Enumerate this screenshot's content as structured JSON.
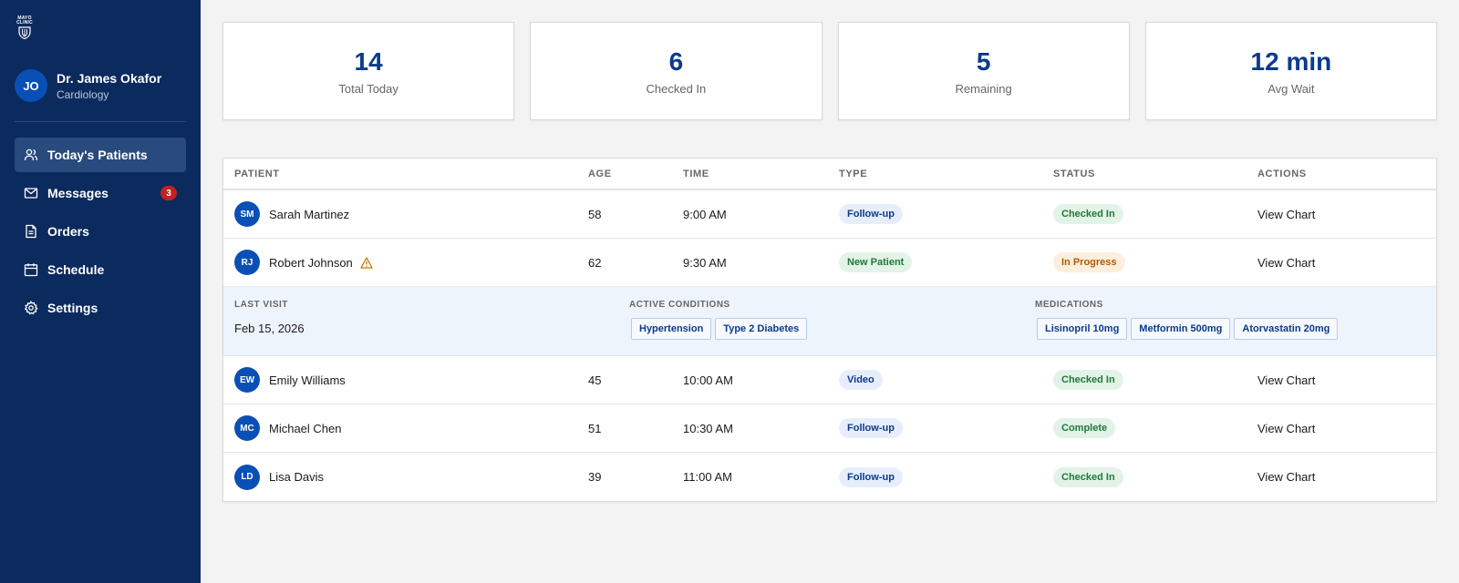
{
  "brand": {
    "logo_text": "MAYO CLINIC"
  },
  "user": {
    "initials": "JO",
    "name": "Dr. James Okafor",
    "department": "Cardiology"
  },
  "nav": {
    "items": [
      {
        "label": "Today's Patients",
        "icon": "users-icon",
        "active": true
      },
      {
        "label": "Messages",
        "icon": "mail-icon",
        "badge": "3"
      },
      {
        "label": "Orders",
        "icon": "document-icon"
      },
      {
        "label": "Schedule",
        "icon": "calendar-icon"
      },
      {
        "label": "Settings",
        "icon": "gear-icon"
      }
    ]
  },
  "stats": [
    {
      "value": "14",
      "label": "Total Today"
    },
    {
      "value": "6",
      "label": "Checked In"
    },
    {
      "value": "5",
      "label": "Remaining"
    },
    {
      "value": "12 min",
      "label": "Avg Wait"
    }
  ],
  "table": {
    "headers": {
      "patient": "PATIENT",
      "age": "AGE",
      "time": "TIME",
      "type": "TYPE",
      "status": "STATUS",
      "actions": "ACTIONS"
    },
    "rows": [
      {
        "initials": "SM",
        "name": "Sarah Martinez",
        "age": "58",
        "time": "9:00 AM",
        "type": "Follow-up",
        "status": "Checked In",
        "action": "View Chart"
      },
      {
        "initials": "RJ",
        "name": "Robert Johnson",
        "age": "62",
        "time": "9:30 AM",
        "type": "New Patient",
        "status": "In Progress",
        "action": "View Chart",
        "warning": true
      },
      {
        "initials": "EW",
        "name": "Emily Williams",
        "age": "45",
        "time": "10:00 AM",
        "type": "Video",
        "status": "Checked In",
        "action": "View Chart"
      },
      {
        "initials": "MC",
        "name": "Michael Chen",
        "age": "51",
        "time": "10:30 AM",
        "type": "Follow-up",
        "status": "Complete",
        "action": "View Chart"
      },
      {
        "initials": "LD",
        "name": "Lisa Davis",
        "age": "39",
        "time": "11:00 AM",
        "type": "Follow-up",
        "status": "Checked In",
        "action": "View Chart"
      }
    ],
    "expanded": {
      "last_visit_label": "LAST VISIT",
      "last_visit": "Feb 15, 2026",
      "conditions_label": "ACTIVE CONDITIONS",
      "conditions": [
        "Hypertension",
        "Type 2 Diabetes"
      ],
      "medications_label": "MEDICATIONS",
      "medications": [
        "Lisinopril 10mg",
        "Metformin 500mg",
        "Atorvastatin 20mg"
      ]
    }
  },
  "colors": {
    "sidebar": "#0b2a5e",
    "accent": "#0a3a8c",
    "badge": "#c62020",
    "green": "#1d7a3a",
    "orange": "#b35a00"
  }
}
